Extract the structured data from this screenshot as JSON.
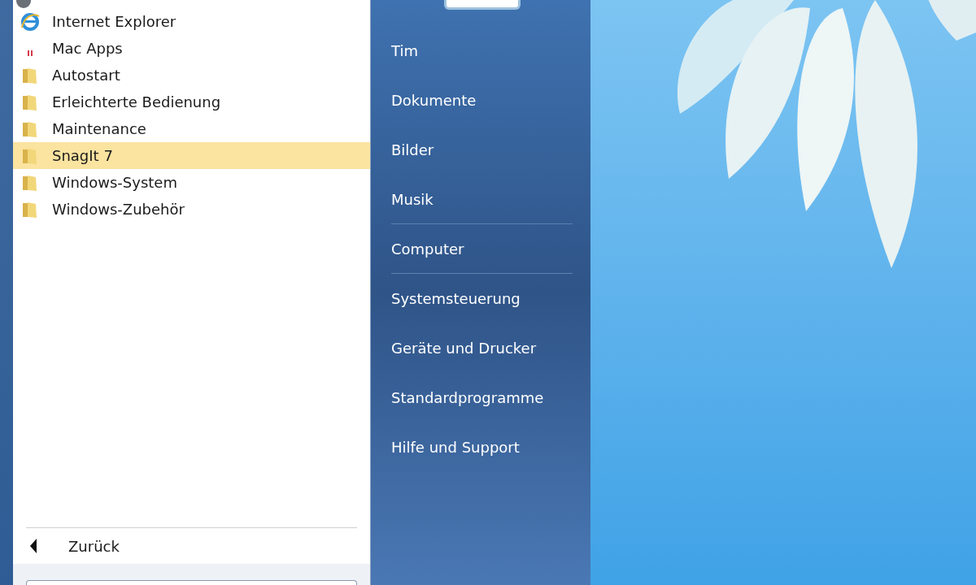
{
  "programs": [
    {
      "kind": "browser",
      "label": "Internet Explorer",
      "selected": false
    },
    {
      "kind": "app",
      "label": "Mac Apps",
      "selected": false
    },
    {
      "kind": "folder",
      "label": "Autostart",
      "selected": false
    },
    {
      "kind": "folder",
      "label": "Erleichterte Bedienung",
      "selected": false
    },
    {
      "kind": "folder",
      "label": "Maintenance",
      "selected": false
    },
    {
      "kind": "folder",
      "label": "SnagIt 7",
      "selected": true
    },
    {
      "kind": "folder",
      "label": "Windows-System",
      "selected": false
    },
    {
      "kind": "folder",
      "label": "Windows-Zubehör",
      "selected": false
    }
  ],
  "back": {
    "label": "Zurück"
  },
  "right_items": [
    {
      "label": "Tim",
      "separator_after": false
    },
    {
      "label": "Dokumente",
      "separator_after": false
    },
    {
      "label": "Bilder",
      "separator_after": false
    },
    {
      "label": "Musik",
      "separator_after": true
    },
    {
      "label": "Computer",
      "separator_after": true
    },
    {
      "label": "Systemsteuerung",
      "separator_after": false
    },
    {
      "label": "Geräte und Drucker",
      "separator_after": false
    },
    {
      "label": "Standardprogramme",
      "separator_after": false
    },
    {
      "label": "Hilfe und Support",
      "separator_after": false
    }
  ]
}
